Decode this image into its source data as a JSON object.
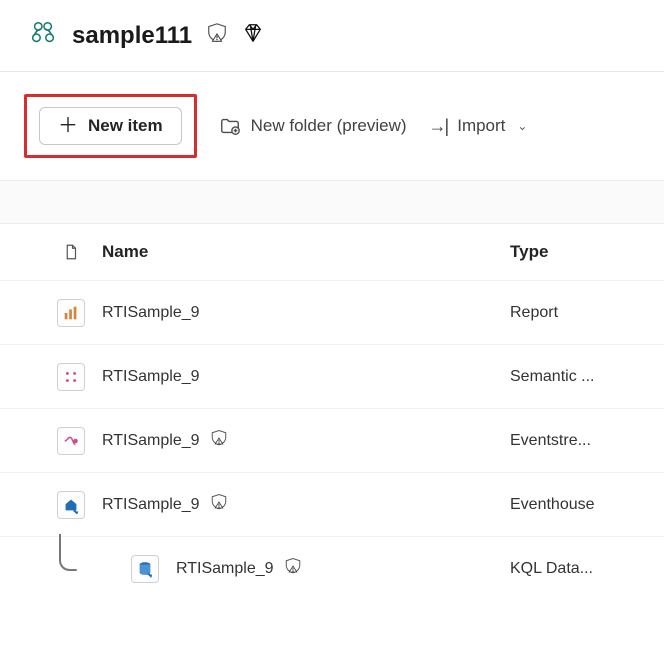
{
  "header": {
    "title": "sample111"
  },
  "toolbar": {
    "new_item": "New item",
    "new_folder": "New folder (preview)",
    "import": "Import"
  },
  "columns": {
    "name": "Name",
    "type": "Type"
  },
  "items": [
    {
      "name": "RTISample_9",
      "type": "Report",
      "icon": "report",
      "warn": false,
      "nested": false
    },
    {
      "name": "RTISample_9",
      "type": "Semantic ...",
      "icon": "semantic",
      "warn": false,
      "nested": false
    },
    {
      "name": "RTISample_9",
      "type": "Eventstre...",
      "icon": "eventstream",
      "warn": true,
      "nested": false
    },
    {
      "name": "RTISample_9",
      "type": "Eventhouse",
      "icon": "eventhouse",
      "warn": true,
      "nested": false
    },
    {
      "name": "RTISample_9",
      "type": "KQL Data...",
      "icon": "kqldb",
      "warn": true,
      "nested": true
    }
  ]
}
